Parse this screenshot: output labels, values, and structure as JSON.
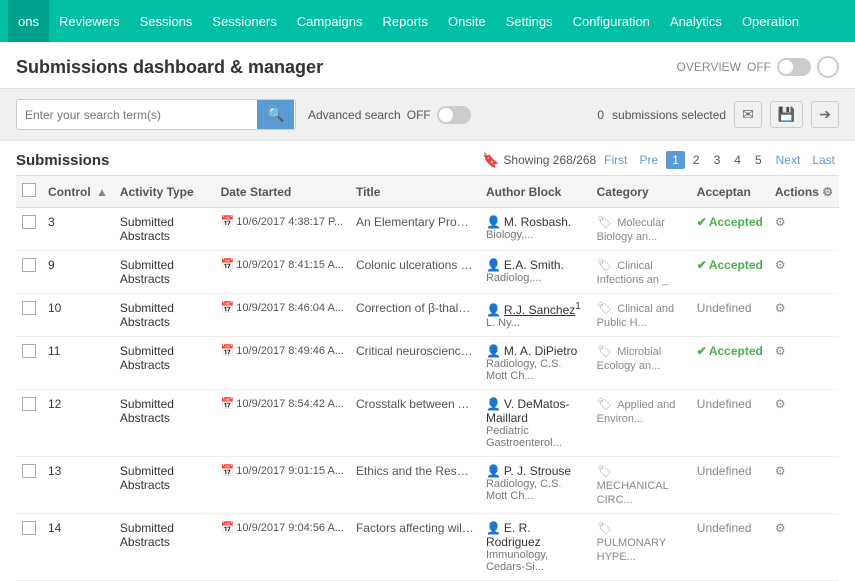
{
  "nav": {
    "items": [
      {
        "label": "ons",
        "active": true
      },
      {
        "label": "Reviewers",
        "active": false
      },
      {
        "label": "Sessions",
        "active": false
      },
      {
        "label": "Sessioners",
        "active": false
      },
      {
        "label": "Campaigns",
        "active": false
      },
      {
        "label": "Reports",
        "active": false
      },
      {
        "label": "Onsite",
        "active": false
      },
      {
        "label": "Settings",
        "active": false
      },
      {
        "label": "Configuration",
        "active": false
      },
      {
        "label": "Analytics",
        "active": false
      },
      {
        "label": "Operation",
        "active": false
      }
    ]
  },
  "header": {
    "title": "Submissions dashboard & manager",
    "overview_label": "OVERVIEW",
    "overview_state": "OFF"
  },
  "search": {
    "placeholder": "Enter your search term(s)",
    "advanced_label": "Advanced search",
    "advanced_state": "OFF",
    "selected_count": "0",
    "selected_label": "submissions selected"
  },
  "table": {
    "section_label": "Submissions",
    "showing_label": "Showing 268/268",
    "first_label": "First",
    "prev_label": "Pre",
    "next_label": "Next",
    "last_label": "Last",
    "pages": [
      "1",
      "2",
      "3",
      "4",
      "5"
    ],
    "active_page": "1",
    "columns": [
      "",
      "Control",
      "Activity Type",
      "Date Started",
      "Title",
      "Author Block",
      "Category",
      "Acceptan",
      "Actions"
    ],
    "rows": [
      {
        "control": "3",
        "activity_type": "Submitted Abstracts",
        "date": "10/6/2017 4:38:17 P...",
        "title": "An Elementary Proof of ...",
        "author_name": "M. Rosbash.",
        "author_affil": "Biology,...",
        "category": "Molecular Biology an...",
        "status": "Accepted",
        "status_type": "accepted"
      },
      {
        "control": "9",
        "activity_type": "Submitted Abstracts",
        "date": "10/9/2017 8:41:15 A...",
        "title": "Colonic ulcerations ma...",
        "author_name": "E.A. Smith.",
        "author_affil": "Radiolog,...",
        "category": "Clinical Infections an _",
        "status": "Accepted",
        "status_type": "accepted"
      },
      {
        "control": "10",
        "activity_type": "Submitted Abstracts",
        "date": "10/9/2017 8:46:04 A...",
        "title": "Correction of β-thalass...",
        "author_name": "R.J. Sanchez",
        "author_affil": "L. Ny...",
        "category": "Clinical and Public H...",
        "status": "Undefined",
        "status_type": "undefined"
      },
      {
        "control": "11",
        "activity_type": "Submitted Abstracts",
        "date": "10/9/2017 8:49:46 A...",
        "title": "Critical neuroscience—...",
        "author_name": "M. A. DiPietro",
        "author_affil": "Radiology, C.S. Mott Ch...",
        "category": "Microbial Ecology an...",
        "status": "Accepted",
        "status_type": "accepted"
      },
      {
        "control": "12",
        "activity_type": "Submitted Abstracts",
        "date": "10/9/2017 8:54:42 A...",
        "title": "Crosstalk between Ani...",
        "author_name": "V. DeMatos-Maillard",
        "author_affil": "Pediatric Gastroenterol...",
        "category": "Applied and Environ...",
        "status": "Undefined",
        "status_type": "undefined"
      },
      {
        "control": "13",
        "activity_type": "Submitted Abstracts",
        "date": "10/9/2017 9:01:15 A...",
        "title": "Ethics and the Respons...",
        "author_name": "P. J. Strouse",
        "author_affil": "Radiology, C.S. Mott Ch...",
        "category": "MECHANICAL CIRC...",
        "status": "Undefined",
        "status_type": "undefined"
      },
      {
        "control": "14",
        "activity_type": "Submitted Abstracts",
        "date": "10/9/2017 9:04:56 A...",
        "title": "Factors affecting willin...",
        "author_name": "E. R. Rodriguez",
        "author_affil": "Immunology, Cedars-Si...",
        "category": "PULMONARY HYPE...",
        "status": "Undefined",
        "status_type": "undefined"
      }
    ]
  }
}
